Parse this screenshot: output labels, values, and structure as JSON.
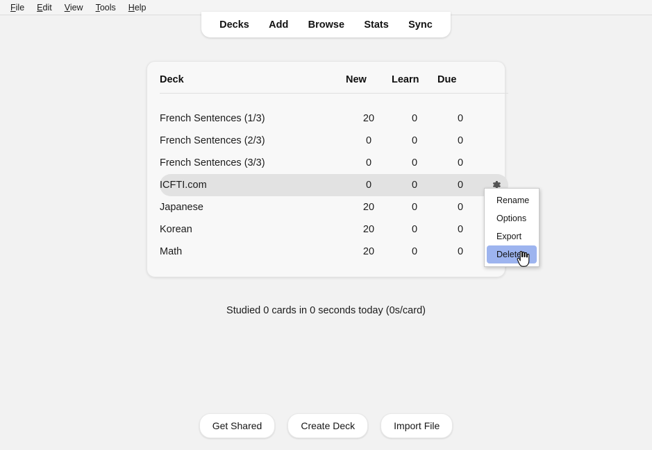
{
  "window": {
    "app_title": "Anki"
  },
  "menubar": {
    "items": [
      {
        "label": "File",
        "accel": "F",
        "rest": "ile"
      },
      {
        "label": "Edit",
        "accel": "E",
        "rest": "dit"
      },
      {
        "label": "View",
        "accel": "V",
        "rest": "iew"
      },
      {
        "label": "Tools",
        "accel": "T",
        "rest": "ools"
      },
      {
        "label": "Help",
        "accel": "H",
        "rest": "elp"
      }
    ]
  },
  "topnav": {
    "items": [
      {
        "label": "Decks"
      },
      {
        "label": "Add"
      },
      {
        "label": "Browse"
      },
      {
        "label": "Stats"
      },
      {
        "label": "Sync"
      }
    ]
  },
  "deck_table": {
    "headers": {
      "deck": "Deck",
      "new": "New",
      "learn": "Learn",
      "due": "Due"
    },
    "rows": [
      {
        "name": "French Sentences (1/3)",
        "new": "20",
        "learn": "0",
        "due": "0",
        "new_is_active": true,
        "selected": false,
        "gear_visible": false
      },
      {
        "name": "French Sentences (2/3)",
        "new": "0",
        "learn": "0",
        "due": "0",
        "new_is_active": false,
        "selected": false,
        "gear_visible": false
      },
      {
        "name": "French Sentences (3/3)",
        "new": "0",
        "learn": "0",
        "due": "0",
        "new_is_active": false,
        "selected": false,
        "gear_visible": false
      },
      {
        "name": "ICFTI.com",
        "new": "0",
        "learn": "0",
        "due": "0",
        "new_is_active": false,
        "selected": true,
        "gear_visible": true
      },
      {
        "name": "Japanese",
        "new": "20",
        "learn": "0",
        "due": "0",
        "new_is_active": true,
        "selected": false,
        "gear_visible": false
      },
      {
        "name": "Korean",
        "new": "20",
        "learn": "0",
        "due": "0",
        "new_is_active": true,
        "selected": false,
        "gear_visible": false
      },
      {
        "name": "Math",
        "new": "20",
        "learn": "0",
        "due": "0",
        "new_is_active": true,
        "selected": false,
        "gear_visible": false
      }
    ]
  },
  "status": {
    "studied_text": "Studied 0 cards in 0 seconds today (0s/card)"
  },
  "bottom_buttons": [
    {
      "label": "Get Shared"
    },
    {
      "label": "Create Deck"
    },
    {
      "label": "Import File"
    }
  ],
  "context_menu": {
    "items": [
      {
        "label": "Rename",
        "highlighted": false
      },
      {
        "label": "Options",
        "highlighted": false
      },
      {
        "label": "Export",
        "highlighted": false
      },
      {
        "label": "Delete",
        "highlighted": true
      }
    ]
  },
  "icons": {
    "gear": "gear-icon",
    "cursor": "pointing-hand-cursor"
  },
  "colors": {
    "accent_blue": "#4a7fd4",
    "zero_gray": "#b4b4b4",
    "selected_row": "#e2e2e2",
    "menu_highlight": "#9db4ef",
    "page_bg": "#f2f2f2",
    "card_bg": "#f8f8f8"
  }
}
